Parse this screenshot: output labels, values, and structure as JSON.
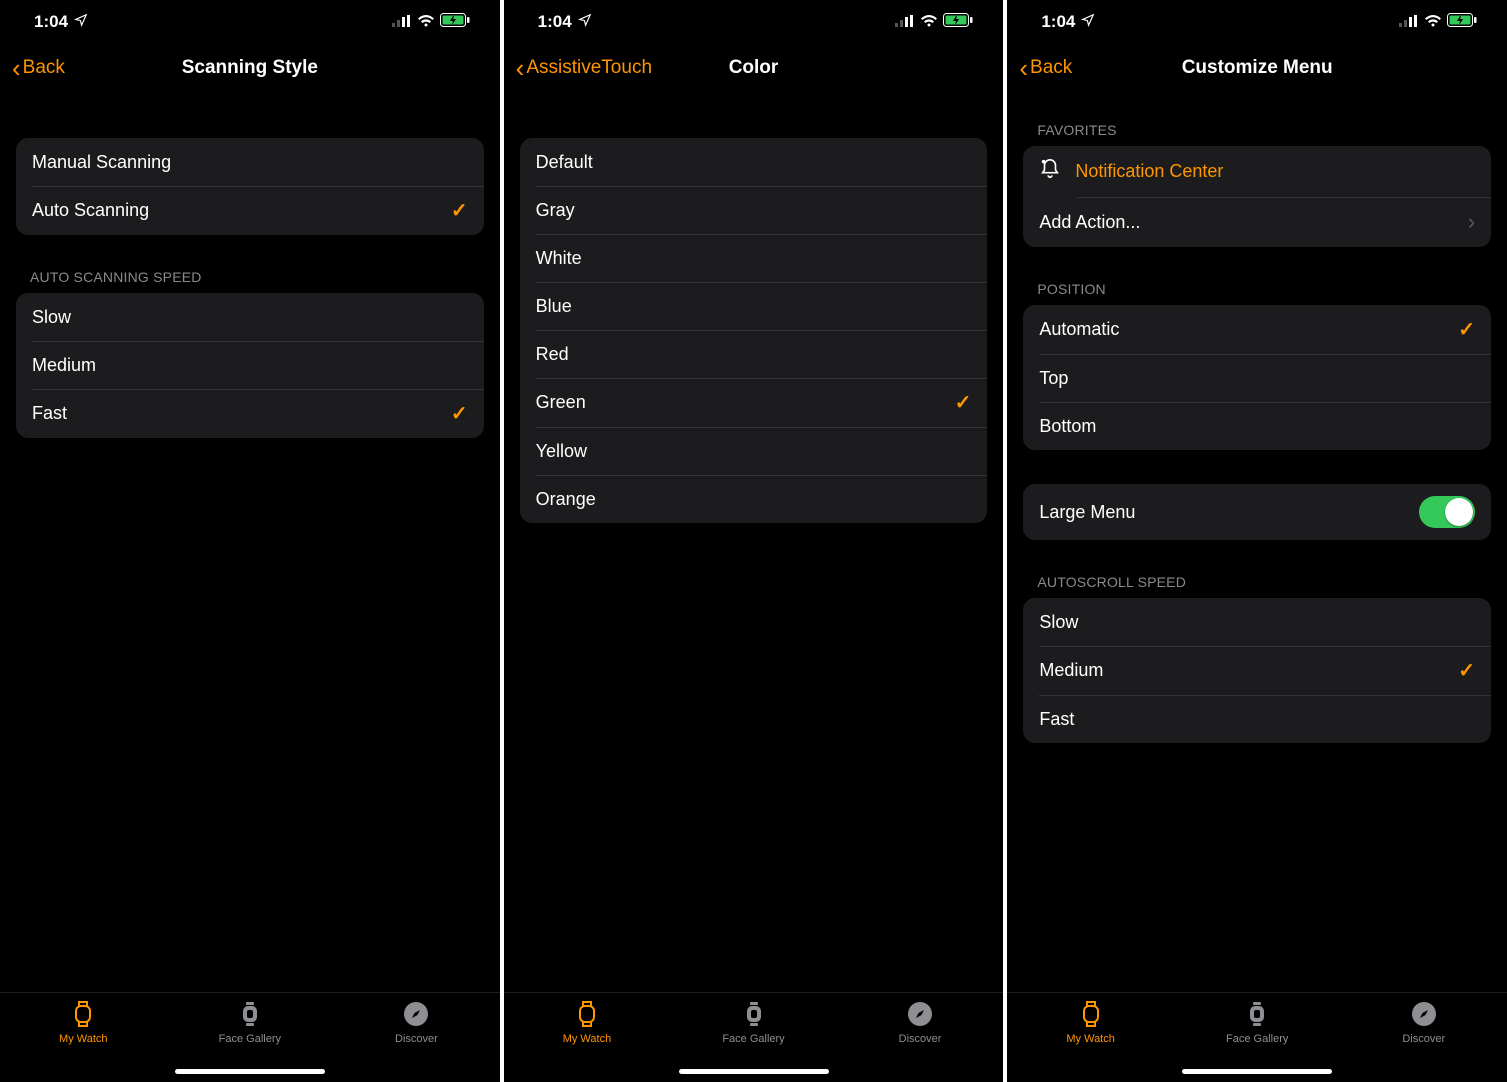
{
  "status": {
    "time": "1:04"
  },
  "tabs": {
    "my_watch": "My Watch",
    "face_gallery": "Face Gallery",
    "discover": "Discover"
  },
  "screens": [
    {
      "back_label": "Back",
      "title": "Scanning Style",
      "group1": [
        {
          "label": "Manual Scanning",
          "selected": false
        },
        {
          "label": "Auto Scanning",
          "selected": true
        }
      ],
      "group2_header": "AUTO SCANNING SPEED",
      "group2": [
        {
          "label": "Slow",
          "selected": false
        },
        {
          "label": "Medium",
          "selected": false
        },
        {
          "label": "Fast",
          "selected": true
        }
      ]
    },
    {
      "back_label": "AssistiveTouch",
      "title": "Color",
      "group1": [
        {
          "label": "Default",
          "selected": false
        },
        {
          "label": "Gray",
          "selected": false
        },
        {
          "label": "White",
          "selected": false
        },
        {
          "label": "Blue",
          "selected": false
        },
        {
          "label": "Red",
          "selected": false
        },
        {
          "label": "Green",
          "selected": true
        },
        {
          "label": "Yellow",
          "selected": false
        },
        {
          "label": "Orange",
          "selected": false
        }
      ]
    },
    {
      "back_label": "Back",
      "title": "Customize Menu",
      "favorites_header": "FAVORITES",
      "favorites": {
        "notification_center": "Notification Center",
        "add_action": "Add Action..."
      },
      "position_header": "POSITION",
      "position": [
        {
          "label": "Automatic",
          "selected": true
        },
        {
          "label": "Top",
          "selected": false
        },
        {
          "label": "Bottom",
          "selected": false
        }
      ],
      "large_menu_label": "Large Menu",
      "large_menu_on": true,
      "autoscroll_header": "AUTOSCROLL SPEED",
      "autoscroll": [
        {
          "label": "Slow",
          "selected": false
        },
        {
          "label": "Medium",
          "selected": true
        },
        {
          "label": "Fast",
          "selected": false
        }
      ]
    }
  ]
}
